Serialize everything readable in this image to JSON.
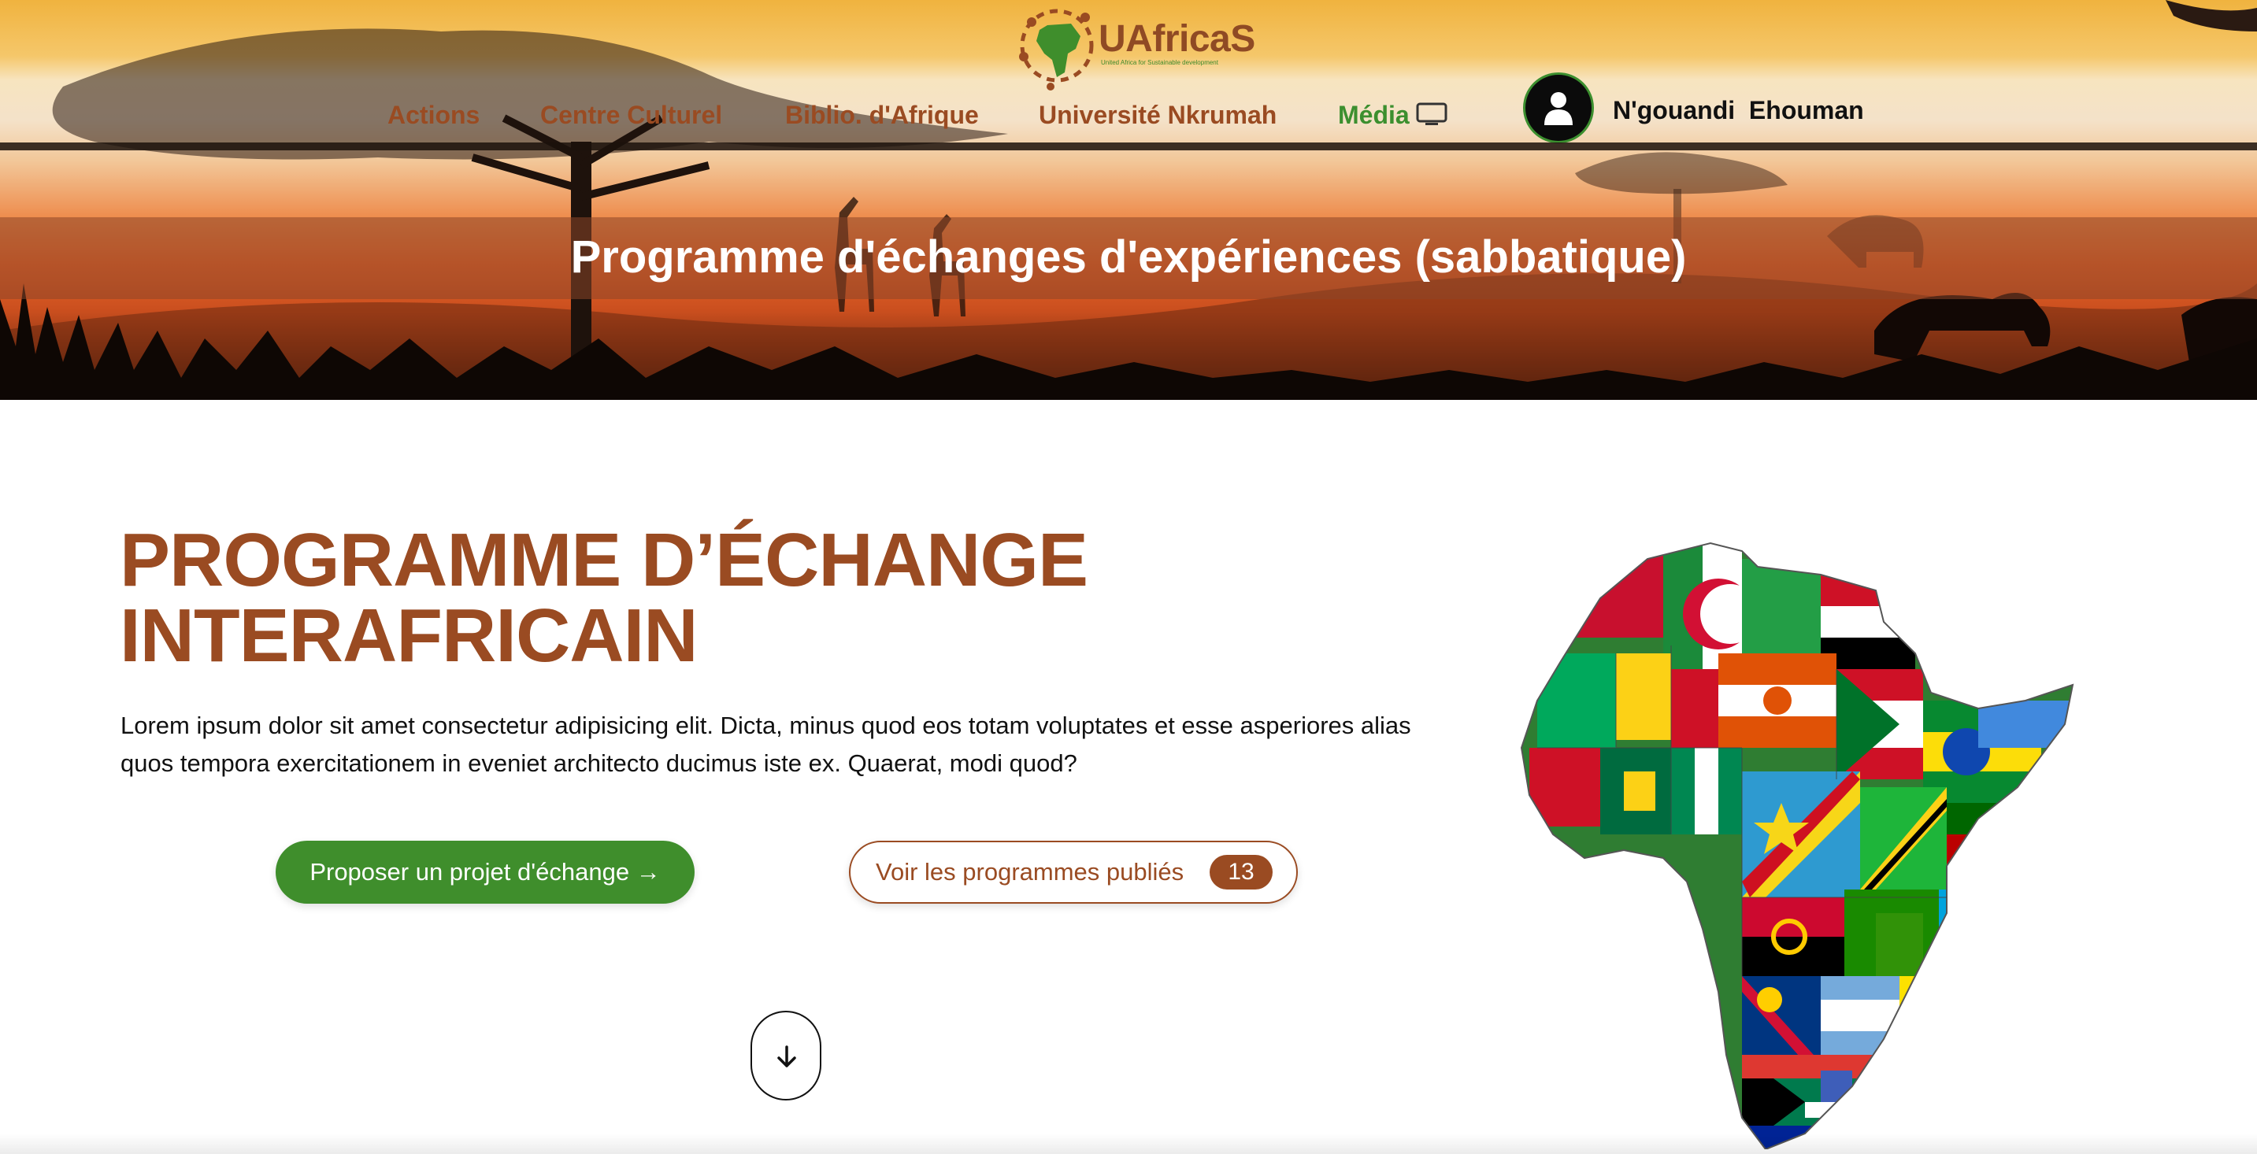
{
  "brand": {
    "name": "UAfricaS",
    "tagline": "United Africa for Sustainable development"
  },
  "nav": {
    "items": [
      {
        "label": "Actions"
      },
      {
        "label": "Centre Culturel"
      },
      {
        "label": "Biblio. d'Afrique"
      },
      {
        "label": "Université Nkrumah"
      },
      {
        "label": "Média"
      }
    ],
    "media_icon": "tv-icon"
  },
  "user": {
    "name": "N'gouandi  Ehouman",
    "avatar_icon": "user-icon"
  },
  "banner": {
    "title": "Programme d'échanges d'expériences (sabbatique)"
  },
  "main": {
    "title_line1": "PROGRAMME D’ÉCHANGE",
    "title_line2": "INTERAFRICAIN",
    "lead": "Lorem ipsum dolor sit amet consectetur adipisicing elit. Dicta, minus quod eos totam voluptates et esse asperiores alias quos tempora exercitationem in eveniet architecto ducimus iste ex. Quaerat, modi quod?",
    "primary_button": "Proposer un projet d'échange →",
    "secondary_button": "Voir les programmes publiés",
    "published_count": "13",
    "scroll_icon": "arrow-down-icon",
    "map_image": "africa-flags-map"
  },
  "colors": {
    "brown": "#9a4b22",
    "green": "#3f8e2c",
    "text": "#111111"
  }
}
